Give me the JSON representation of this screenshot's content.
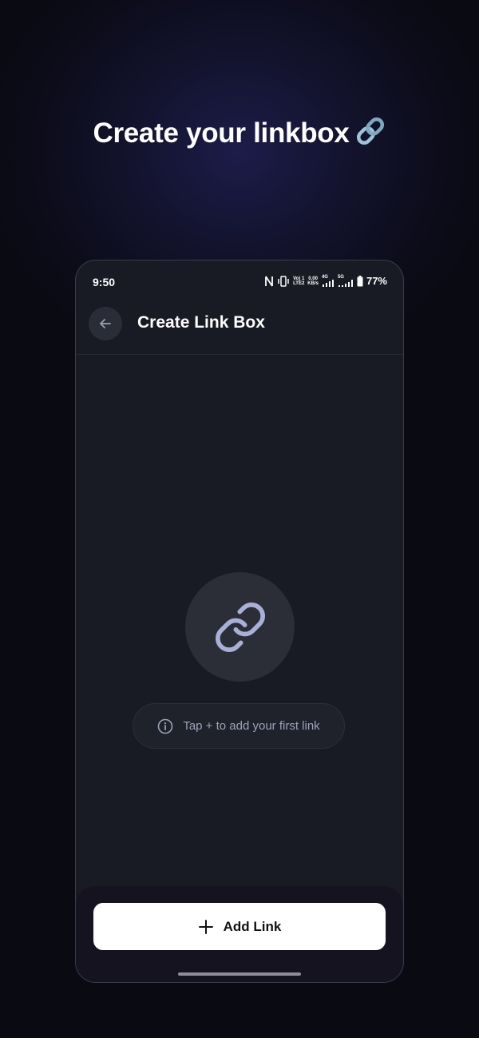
{
  "headline": {
    "text": "Create your linkbox",
    "emoji": "🔗"
  },
  "status_bar": {
    "time": "9:50",
    "volte_top": "Vo) 1",
    "volte_bottom": "LTE2",
    "speed_top": "0.00",
    "speed_bottom": "KB/s",
    "net1": "4G",
    "net2": "5G",
    "battery_percent": "77%",
    "icons": [
      "nfc-icon",
      "vibrate-icon",
      "signal-icon",
      "battery-icon"
    ]
  },
  "header": {
    "title": "Create Link Box",
    "back_icon": "arrow-left-icon"
  },
  "empty_state": {
    "icon": "link-icon",
    "hint_icon": "info-icon",
    "hint_text": "Tap + to add your first link"
  },
  "bottom": {
    "add_label": "Add Link",
    "add_icon": "plus-icon"
  },
  "colors": {
    "background": "#0c0c1a",
    "phone_surface": "#181b23",
    "accent_icon": "#a8b0d6",
    "hint_text": "#9aa3b8",
    "button_bg": "#ffffff"
  }
}
